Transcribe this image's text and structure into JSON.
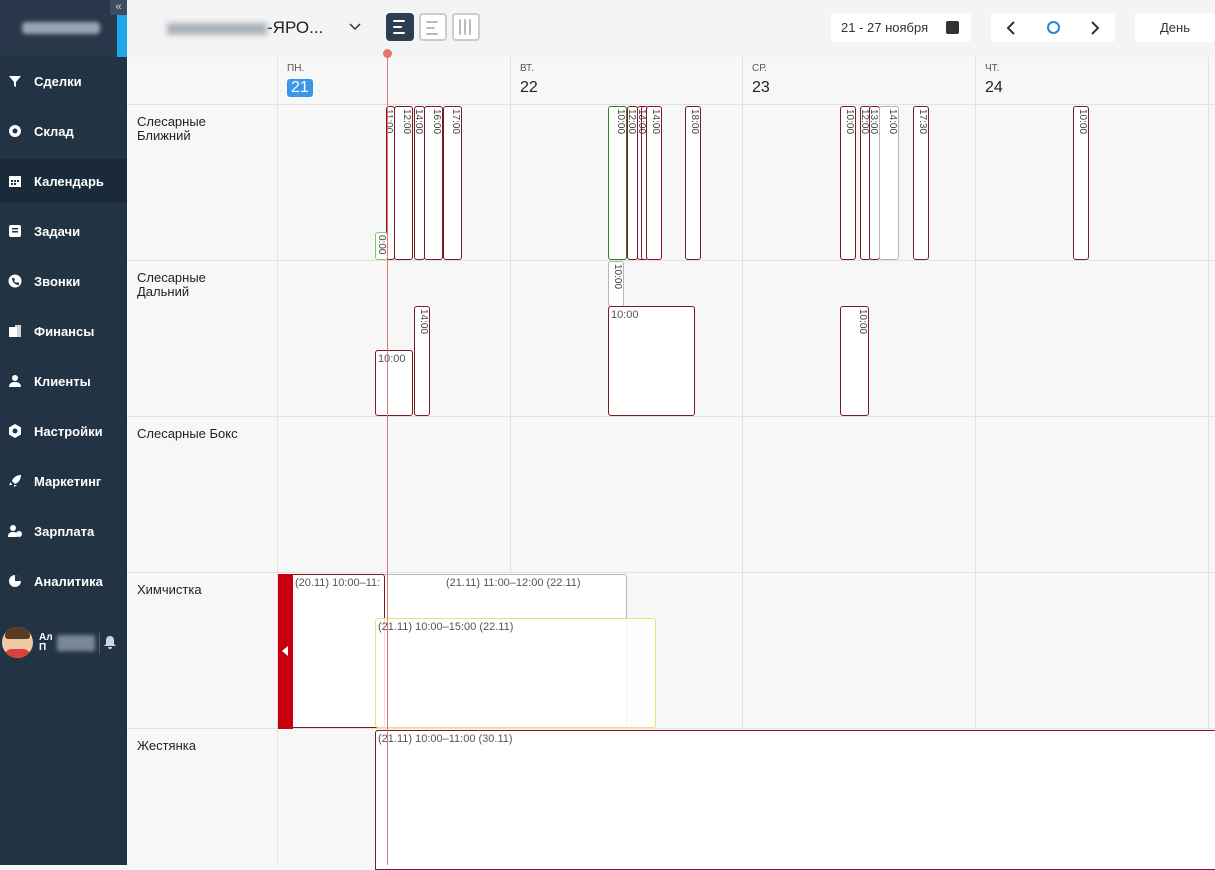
{
  "sidebar": {
    "collapse_glyph": "«",
    "items": [
      {
        "label": "Сделки",
        "icon": "funnel-icon"
      },
      {
        "label": "Склад",
        "icon": "warehouse-icon"
      },
      {
        "label": "Календарь",
        "icon": "calendar-icon",
        "active": true
      },
      {
        "label": "Задачи",
        "icon": "tasks-icon"
      },
      {
        "label": "Звонки",
        "icon": "phone-icon"
      },
      {
        "label": "Финансы",
        "icon": "finance-icon"
      },
      {
        "label": "Клиенты",
        "icon": "clients-icon"
      },
      {
        "label": "Настройки",
        "icon": "gear-icon"
      },
      {
        "label": "Маркетинг",
        "icon": "rocket-icon"
      },
      {
        "label": "Зарплата",
        "icon": "salary-icon"
      },
      {
        "label": "Аналитика",
        "icon": "pie-chart-icon"
      }
    ],
    "user": {
      "line1": "Ал",
      "line2": "П",
      "bell": "🔔"
    }
  },
  "topbar": {
    "project_suffix": "-ЯРО...",
    "caret": "⌵",
    "date_range": "21 - 27 ноября",
    "prev": "‹",
    "next": "›",
    "day_button": "День"
  },
  "days": [
    {
      "dn": "ПН.",
      "dd": "21",
      "today": true
    },
    {
      "dn": "ВТ.",
      "dd": "22"
    },
    {
      "dn": "СР.",
      "dd": "23"
    },
    {
      "dn": "ЧТ.",
      "dd": "24"
    }
  ],
  "resources": [
    {
      "line1": "Слесарные",
      "line2": "Ближний"
    },
    {
      "line1": "Слесарные",
      "line2": "Дальний"
    },
    {
      "line1": "Слесарные Бокс",
      "line2": ""
    },
    {
      "line1": "Химчистка",
      "line2": ""
    },
    {
      "line1": "Жестянка",
      "line2": ""
    }
  ],
  "events": {
    "r1": [
      "11:00",
      "12:00",
      "14:00",
      "16:00",
      "17:00",
      "0:00",
      "10:00",
      "12:00",
      "13:00",
      "14:00",
      "14:00",
      "18:00",
      "10:00",
      "12:00",
      "13:00",
      "14:00",
      "17:30",
      "10:00"
    ],
    "r2": [
      "10:00",
      "14:00",
      "10:00",
      "10:00",
      "10:00"
    ],
    "r4": [
      "(20.11) 10:00–11:",
      "(21.11) 11:00–12:00 (22.11)",
      "(21.11) 10:00–15:00 (22.11)"
    ],
    "r5": [
      "(21.11) 10:00–11:00 (30.11)"
    ]
  },
  "colors": {
    "sidebar": "#223344",
    "accent": "#1ea7e8",
    "today": "#3d97e8",
    "event_border": "#7a1a24",
    "now_line": "#e57373",
    "red_marker": "#c8000d"
  }
}
